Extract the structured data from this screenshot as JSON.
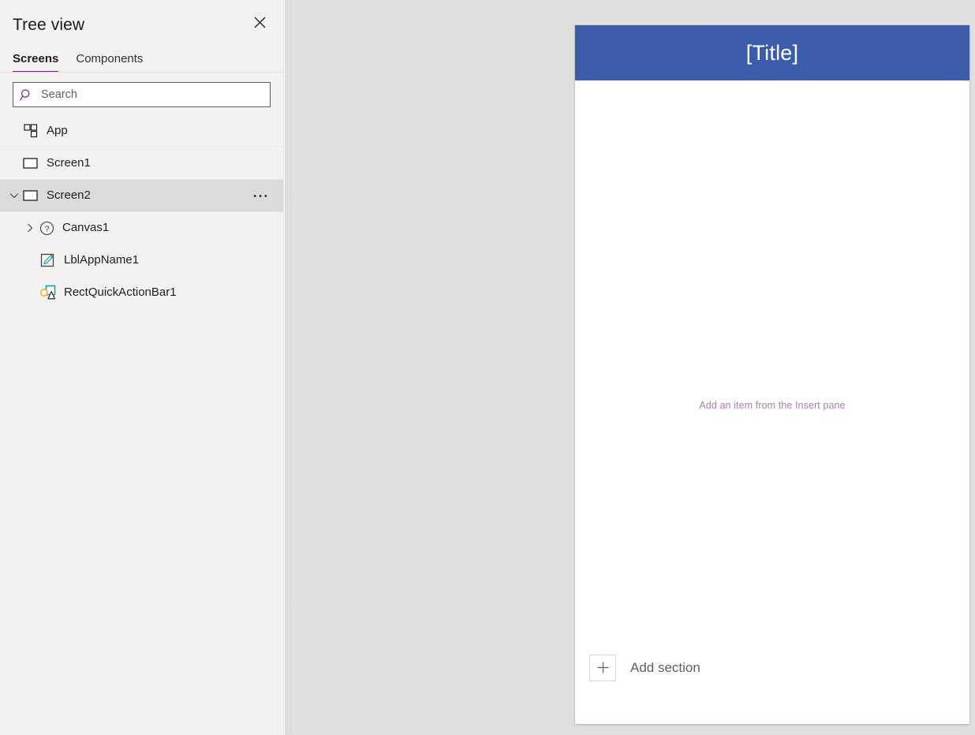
{
  "panel": {
    "title": "Tree view",
    "close_icon": "close-icon",
    "tabs": [
      {
        "label": "Screens",
        "active": true
      },
      {
        "label": "Components",
        "active": false
      }
    ],
    "search": {
      "placeholder": "Search",
      "value": "",
      "icon": "search-icon"
    },
    "tree": [
      {
        "label": "App",
        "icon": "app-grid-icon",
        "indent": 0,
        "chevron": "none",
        "selected": false,
        "more": false
      },
      {
        "label": "Screen1",
        "icon": "screen-rect-icon",
        "indent": 0,
        "chevron": "none",
        "selected": false,
        "more": false
      },
      {
        "label": "Screen2",
        "icon": "screen-rect-icon",
        "indent": 0,
        "chevron": "down",
        "selected": true,
        "more": true,
        "more_icon": "ellipsis-icon"
      },
      {
        "label": "Canvas1",
        "icon": "question-circle-icon",
        "indent": 1,
        "chevron": "right",
        "selected": false,
        "more": false
      },
      {
        "label": "LblAppName1",
        "icon": "label-pencil-icon",
        "indent": 2,
        "chevron": "none",
        "selected": false,
        "more": false
      },
      {
        "label": "RectQuickActionBar1",
        "icon": "shapes-icon",
        "indent": 2,
        "chevron": "none",
        "selected": false,
        "more": false
      }
    ]
  },
  "canvas": {
    "screen": {
      "title": "[Title]",
      "placeholder_text": "Add an item from the Insert pane",
      "add_section_label": "Add section",
      "add_section_icon": "plus-icon"
    }
  },
  "colors": {
    "accent_purple": "#742774",
    "panel_background": "#f3f2f1",
    "canvas_background": "#e0dfde",
    "title_bar_blue": "#3b5daa",
    "placeholder_mauve": "#b07cb0",
    "selected_row": "#dbdbdb",
    "icon_teal": "#1a9a9a",
    "icon_orange": "#f5a623"
  }
}
